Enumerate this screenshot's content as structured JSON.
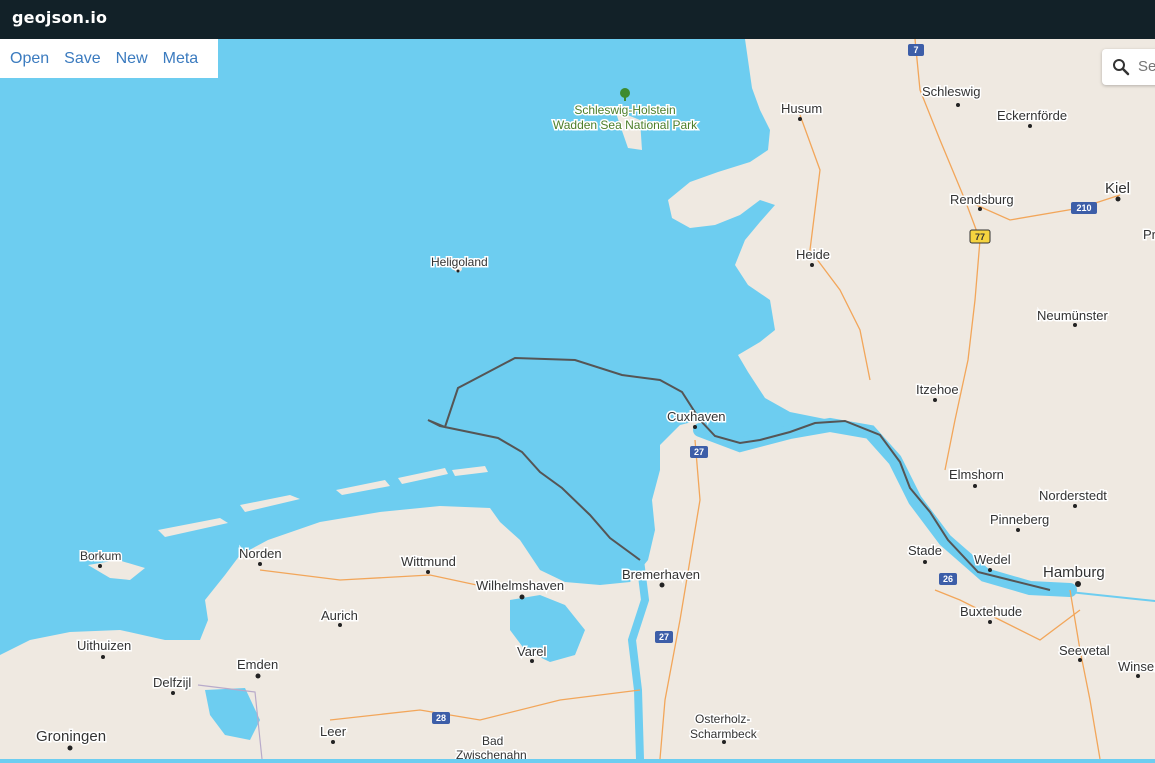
{
  "app": {
    "title": "geojson.io"
  },
  "menu": {
    "open": "Open",
    "save": "Save",
    "new": "New",
    "meta": "Meta"
  },
  "search": {
    "placeholder": "Se"
  },
  "map": {
    "cities": {
      "husum": "Husum",
      "schleswig": "Schleswig",
      "eckernforde": "Eckernförde",
      "kiel": "Kiel",
      "rendsburg": "Rendsburg",
      "heide": "Heide",
      "neumunster": "Neumünster",
      "heligoland": "Heligoland",
      "itzehoe": "Itzehoe",
      "cuxhaven": "Cuxhaven",
      "elmshorn": "Elmshorn",
      "norderstedt": "Norderstedt",
      "pinneberg": "Pinneberg",
      "stade": "Stade",
      "wedel": "Wedel",
      "hamburg": "Hamburg",
      "buxtehude": "Buxtehude",
      "seevetal": "Seevetal",
      "winsen": "Winsen",
      "bremerhaven": "Bremerhaven",
      "borkum": "Borkum",
      "norden": "Norden",
      "wittmund": "Wittmund",
      "wilhelmshaven": "Wilhelmshaven",
      "aurich": "Aurich",
      "uithuizen": "Uithuizen",
      "emden": "Emden",
      "delfzijl": "Delfzijl",
      "varel": "Varel",
      "groningen": "Groningen",
      "leer": "Leer",
      "osterholz_1": "Osterholz-",
      "osterholz_2": "Scharmbeck",
      "bad_1": "Bad",
      "bad_2": "Zwischenahn",
      "pr": "Pr"
    },
    "park": {
      "line1": "Schleswig-Holstein",
      "line2": "Wadden Sea National Park"
    },
    "shields": {
      "a7": "7",
      "b210": "210",
      "a77": "77",
      "a27a": "27",
      "a27b": "27",
      "a26": "26",
      "a28": "28"
    },
    "colors": {
      "water": "#6dcdf0",
      "land": "#efe9e1",
      "route": "#555555",
      "topbar": "#122128",
      "link": "#3b7bbf"
    }
  }
}
